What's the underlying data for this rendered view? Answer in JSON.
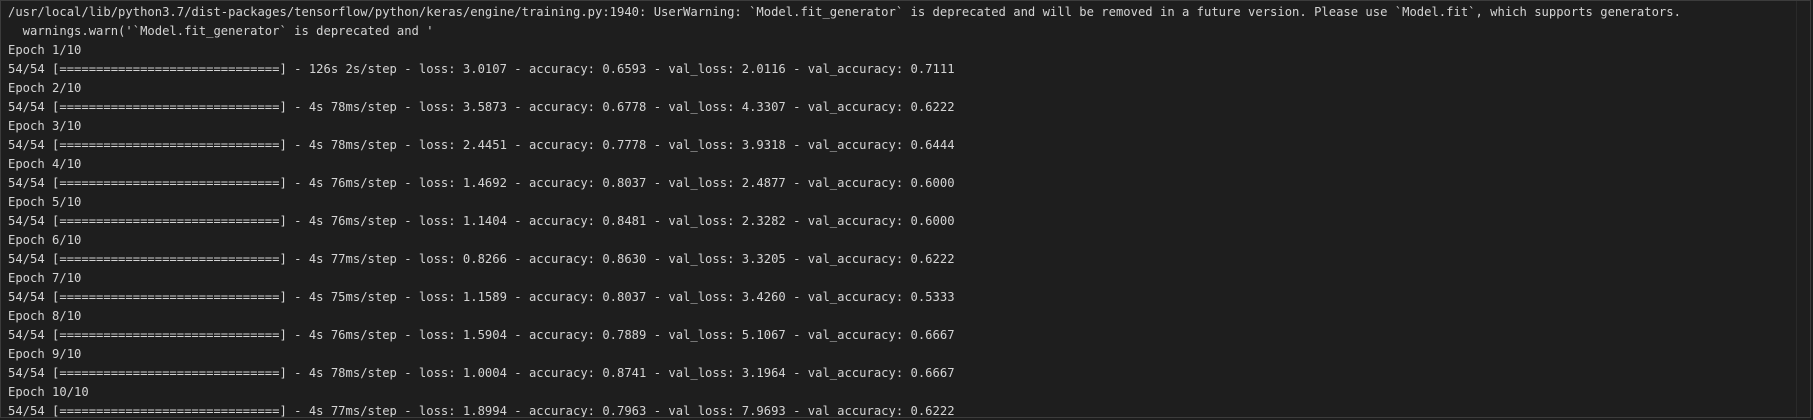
{
  "terminal": {
    "lines": [
      "/usr/local/lib/python3.7/dist-packages/tensorflow/python/keras/engine/training.py:1940: UserWarning: `Model.fit_generator` is deprecated and will be removed in a future version. Please use `Model.fit`, which supports generators.",
      "  warnings.warn('`Model.fit_generator` is deprecated and '",
      "Epoch 1/10",
      "54/54 [==============================] - 126s 2s/step - loss: 3.0107 - accuracy: 0.6593 - val_loss: 2.0116 - val_accuracy: 0.7111",
      "Epoch 2/10",
      "54/54 [==============================] - 4s 78ms/step - loss: 3.5873 - accuracy: 0.6778 - val_loss: 4.3307 - val_accuracy: 0.6222",
      "Epoch 3/10",
      "54/54 [==============================] - 4s 78ms/step - loss: 2.4451 - accuracy: 0.7778 - val_loss: 3.9318 - val_accuracy: 0.6444",
      "Epoch 4/10",
      "54/54 [==============================] - 4s 76ms/step - loss: 1.4692 - accuracy: 0.8037 - val_loss: 2.4877 - val_accuracy: 0.6000",
      "Epoch 5/10",
      "54/54 [==============================] - 4s 76ms/step - loss: 1.1404 - accuracy: 0.8481 - val_loss: 2.3282 - val_accuracy: 0.6000",
      "Epoch 6/10",
      "54/54 [==============================] - 4s 77ms/step - loss: 0.8266 - accuracy: 0.8630 - val_loss: 3.3205 - val_accuracy: 0.6222",
      "Epoch 7/10",
      "54/54 [==============================] - 4s 75ms/step - loss: 1.1589 - accuracy: 0.8037 - val_loss: 3.4260 - val_accuracy: 0.5333",
      "Epoch 8/10",
      "54/54 [==============================] - 4s 76ms/step - loss: 1.5904 - accuracy: 0.7889 - val_loss: 5.1067 - val_accuracy: 0.6667",
      "Epoch 9/10",
      "54/54 [==============================] - 4s 78ms/step - loss: 1.0004 - accuracy: 0.8741 - val_loss: 3.1964 - val_accuracy: 0.6667",
      "Epoch 10/10",
      "54/54 [==============================] - 4s 77ms/step - loss: 1.8994 - accuracy: 0.7963 - val_loss: 7.9693 - val_accuracy: 0.6222"
    ]
  },
  "colors": {
    "background": "#1e1e1e",
    "text": "#d4d4d4",
    "border": "#3c3c3c"
  }
}
